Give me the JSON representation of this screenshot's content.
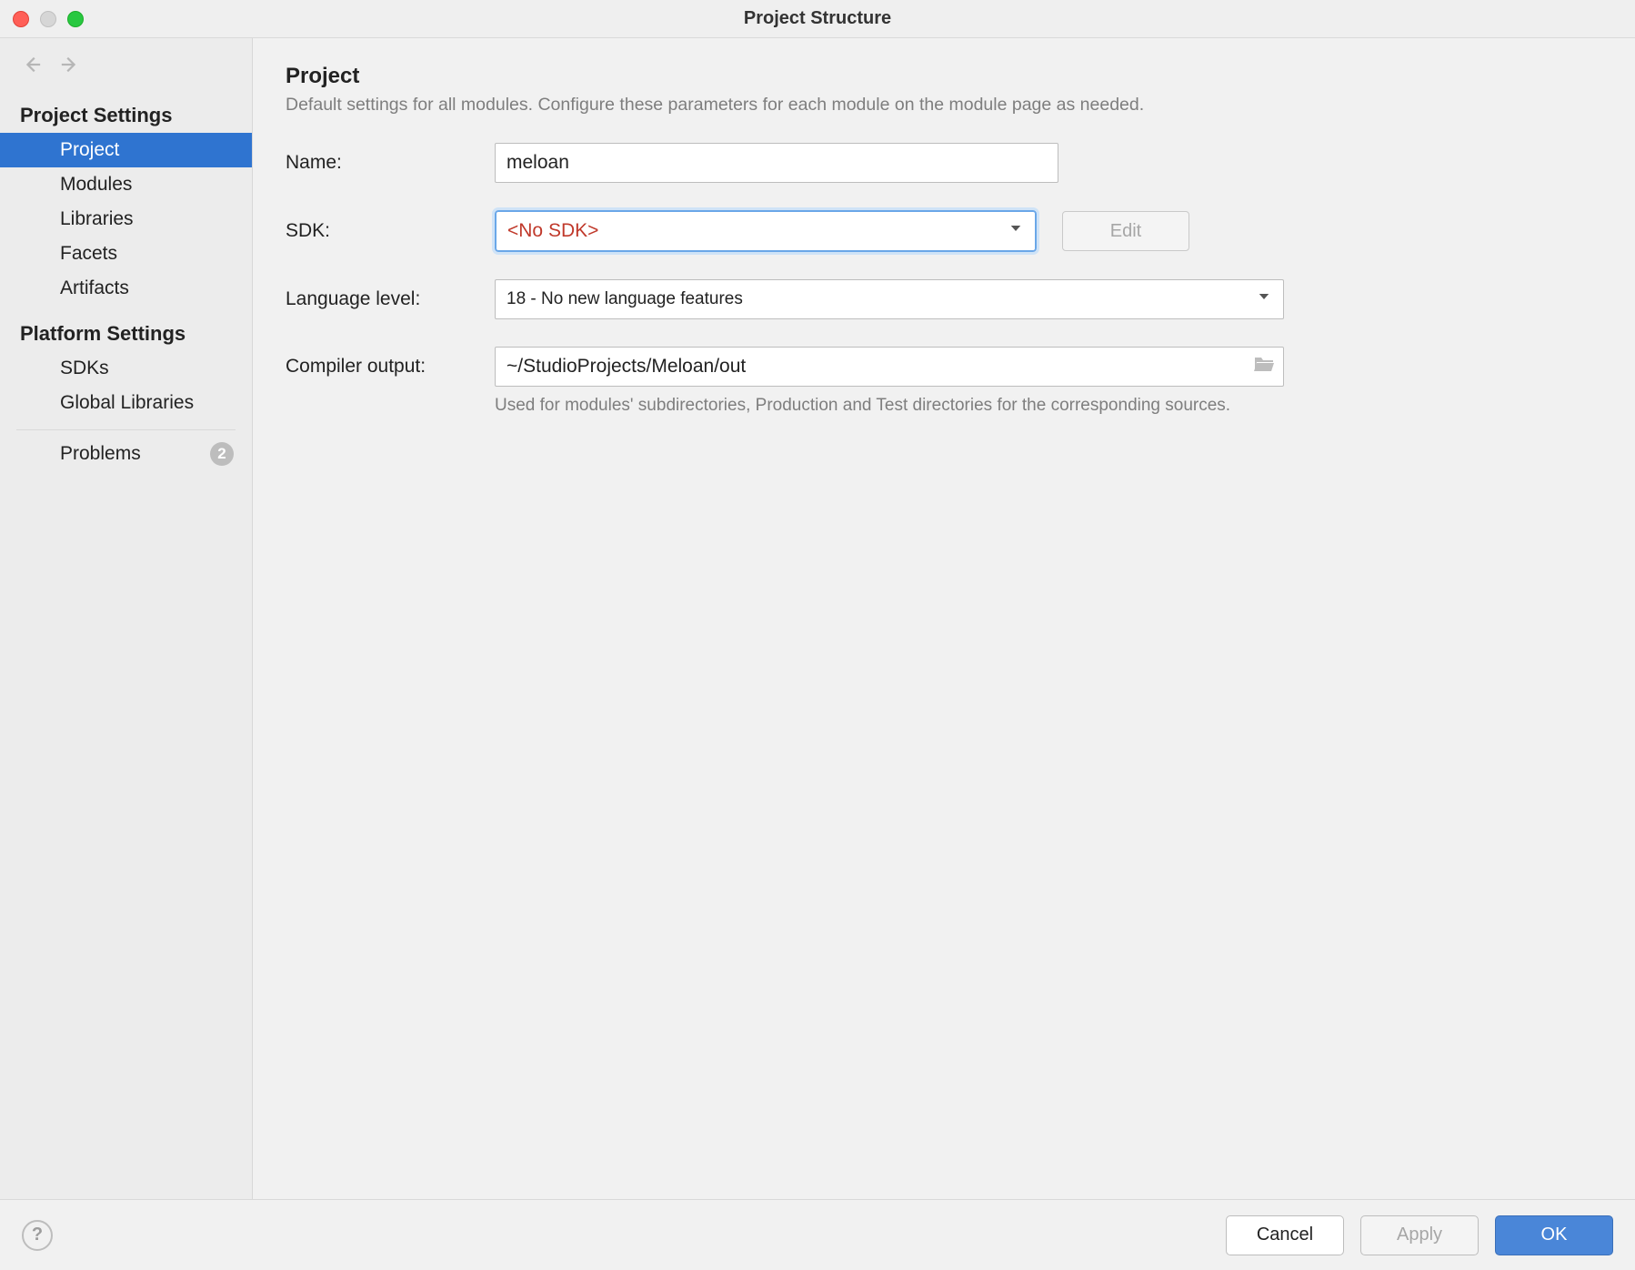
{
  "window": {
    "title": "Project Structure"
  },
  "sidebar": {
    "sections": {
      "project_settings": {
        "header": "Project Settings",
        "items": [
          "Project",
          "Modules",
          "Libraries",
          "Facets",
          "Artifacts"
        ],
        "selected_index": 0
      },
      "platform_settings": {
        "header": "Platform Settings",
        "items": [
          "SDKs",
          "Global Libraries"
        ]
      },
      "problems": {
        "label": "Problems",
        "badge": "2"
      }
    }
  },
  "main": {
    "title": "Project",
    "subtitle": "Default settings for all modules. Configure these parameters for each module on the module page as needed.",
    "labels": {
      "name": "Name:",
      "sdk": "SDK:",
      "language_level": "Language level:",
      "compiler_output": "Compiler output:"
    },
    "name_value": "meloan",
    "sdk_value": "<No SDK>",
    "edit_button": "Edit",
    "language_level_value": "18 - No new language features",
    "compiler_output_value": "~/StudioProjects/Meloan/out",
    "compiler_output_hint": "Used for modules' subdirectories, Production and Test directories for the corresponding sources."
  },
  "footer": {
    "cancel": "Cancel",
    "apply": "Apply",
    "ok": "OK"
  }
}
